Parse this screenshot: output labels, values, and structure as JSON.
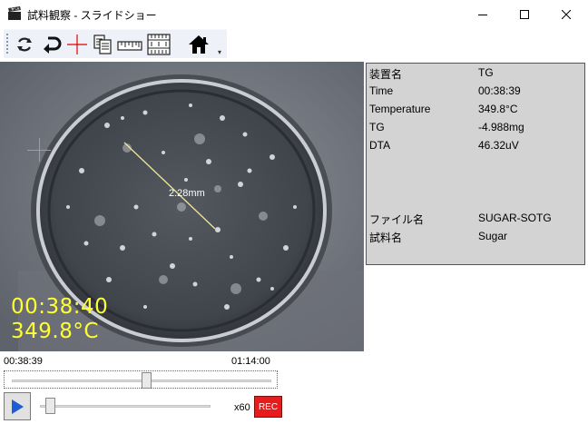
{
  "window": {
    "title": "試料観察 - スライドショー",
    "icons": {
      "app": "film-clapper-icon",
      "minimize": "minimize-icon",
      "maximize": "maximize-icon",
      "close": "close-icon"
    }
  },
  "toolbar": {
    "buttons": [
      {
        "name": "rotate-icon"
      },
      {
        "name": "undo-arrow-icon"
      },
      {
        "name": "crosshair-icon"
      },
      {
        "name": "copy-document-icon"
      },
      {
        "name": "ruler-icon"
      },
      {
        "name": "scale-grid-icon"
      },
      {
        "name": "home-icon"
      }
    ]
  },
  "video": {
    "overlay_time": "00:38:40",
    "overlay_temperature": "349.8°C",
    "measurement_label": "2.28mm",
    "overlay_color": "#ffff33"
  },
  "info_panel": {
    "rows": [
      {
        "key": "装置名",
        "value": "TG"
      },
      {
        "key": "Time",
        "value": "00:38:39"
      },
      {
        "key": "Temperature",
        "value": "349.8°C"
      },
      {
        "key": "TG",
        "value": "-4.988mg"
      },
      {
        "key": "DTA",
        "value": "46.32uV"
      },
      {
        "key": "ファイル名",
        "value": "SUGAR-SOTG"
      },
      {
        "key": "試料名",
        "value": "Sugar"
      }
    ]
  },
  "timeline": {
    "start_time": "00:38:39",
    "end_time": "01:14:00",
    "position_fraction": 0.52
  },
  "playback": {
    "speed_label": "x60",
    "rec_label": "REC",
    "rec_color": "#e81c1c",
    "speed_position_fraction": 0.04
  }
}
